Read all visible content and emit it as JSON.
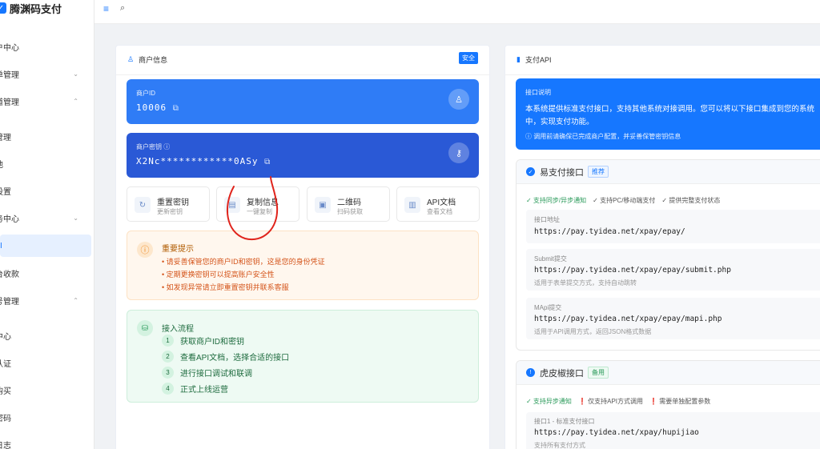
{
  "app": {
    "title": "腾渊码支付"
  },
  "sidebar": {
    "items": [
      {
        "label": "户中心",
        "chev": ""
      },
      {
        "label": "单管理",
        "chev": "⌄"
      },
      {
        "label": "道管理",
        "chev": "⌃"
      },
      {
        "label": "管理",
        "chev": ""
      },
      {
        "label": "池",
        "chev": ""
      },
      {
        "label": "设置",
        "chev": ""
      },
      {
        "label": "务中心",
        "chev": "⌄"
      },
      {
        "label": "I",
        "chev": ""
      },
      {
        "label": "台收款",
        "chev": ""
      },
      {
        "label": "号管理",
        "chev": "⌃"
      },
      {
        "label": "中心",
        "chev": ""
      },
      {
        "label": "认证",
        "chev": ""
      },
      {
        "label": "购买",
        "chev": ""
      },
      {
        "label": "密码",
        "chev": ""
      },
      {
        "label": "日志",
        "chev": ""
      }
    ],
    "active_index": 7
  },
  "merchant": {
    "title": "商户信息",
    "badge": "安全",
    "id_label": "商户ID",
    "id_value": "10006",
    "key_label": "商户密钥",
    "key_info": "ⓘ",
    "key_value": "X2Nc************0ASy",
    "actions": [
      {
        "title": "重置密钥",
        "sub": "更新密钥",
        "icon": "↻"
      },
      {
        "title": "复制信息",
        "sub": "一键复制",
        "icon": "▤"
      },
      {
        "title": "二维码",
        "sub": "扫码获取",
        "icon": "▣"
      },
      {
        "title": "API文档",
        "sub": "查看文档",
        "icon": "▥"
      }
    ],
    "notice": {
      "title": "重要提示",
      "lines": [
        "• 请妥善保管您的商户ID和密钥，这是您的身份凭证",
        "• 定期更换密钥可以提高账户安全性",
        "• 如发现异常请立即重置密钥并联系客服"
      ]
    },
    "flow": {
      "title": "接入流程",
      "steps": [
        {
          "n": "1",
          "text": "获取商户ID和密钥"
        },
        {
          "n": "2",
          "text": "查看API文档，选择合适的接口"
        },
        {
          "n": "3",
          "text": "进行接口调试和联调"
        },
        {
          "n": "4",
          "text": "正式上线运营"
        }
      ]
    }
  },
  "api": {
    "title": "支付API",
    "intro": {
      "title": "接口说明",
      "line1": "本系统提供标准支付接口，支持其他系统对接调用。您可以将以下接口集成到您的系统",
      "line2": "中，实现支付功能。",
      "note": "ⓘ 调用前请确保已完成商户配置，并妥善保管密钥信息"
    },
    "epay": {
      "title": "易支付接口",
      "tag": "推荐",
      "features": [
        "✓ 支持同步/异步通知",
        "✓ 支持PC/移动端支付",
        "✓ 提供完整支付状态"
      ],
      "endpoints": [
        {
          "label": "接口地址",
          "url": "https://pay.tyidea.net/xpay/epay/",
          "desc": ""
        },
        {
          "label": "Submit提交",
          "url": "https://pay.tyidea.net/xpay/epay/submit.php",
          "desc": "适用于表单提交方式，支持自动跳转"
        },
        {
          "label": "MApi提交",
          "url": "https://pay.tyidea.net/xpay/epay/mapi.php",
          "desc": "适用于API调用方式，返回JSON格式数据"
        }
      ]
    },
    "hupijiao": {
      "title": "虎皮椒接口",
      "tag": "备用",
      "features": [
        "✓ 支持异步通知",
        "❗ 仅支持API方式调用",
        "❗ 需要单独配置参数"
      ],
      "endpoint": {
        "label": "接口1 - 标准支付接口",
        "url": "https://pay.tyidea.net/xpay/hupijiao",
        "desc": "支持所有支付方式"
      }
    }
  },
  "colors": {
    "primary": "#1677ff",
    "annotation": "#e0241c"
  }
}
